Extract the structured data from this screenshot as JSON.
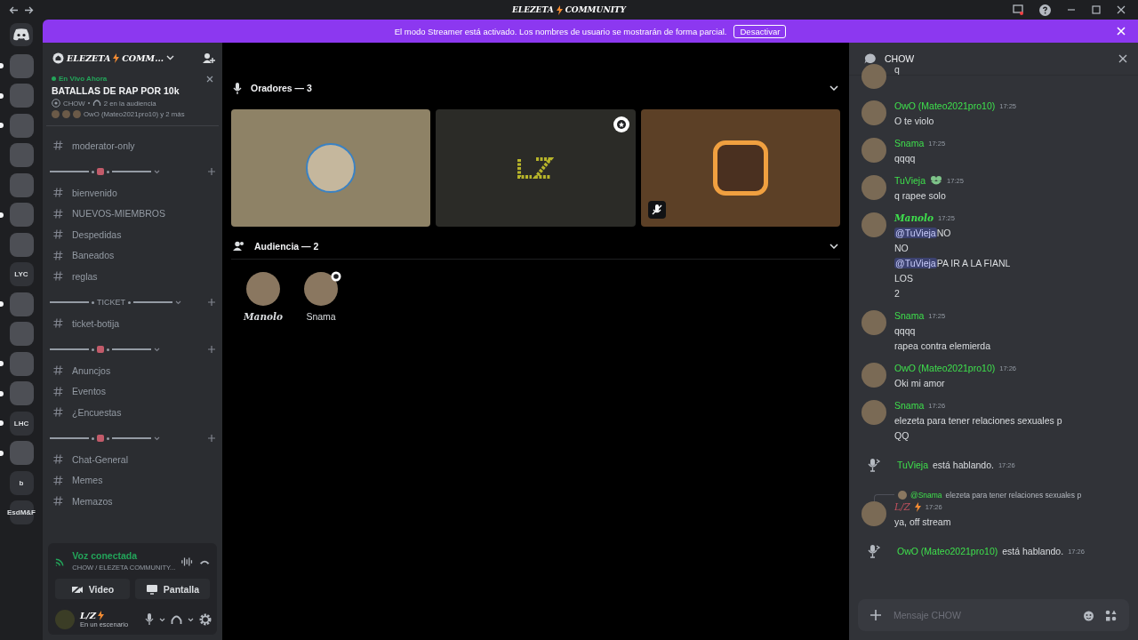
{
  "titlebar": {
    "title": "ELEZETA",
    "title_suffix": "COMMUNITY"
  },
  "banner": {
    "text": "El modo Streamer está activado. Los nombres de usuario se mostrarán de forma parcial.",
    "button": "Desactivar"
  },
  "servers": [
    {
      "unread": true
    },
    {
      "unread": true
    },
    {
      "unread": true
    },
    {
      "unread": false
    },
    {
      "unread": false
    },
    {
      "unread": true
    },
    {
      "unread": false
    },
    {
      "label": "LYC",
      "unread": false
    },
    {
      "unread": true
    },
    {
      "unread": false
    },
    {
      "unread": true
    },
    {
      "unread": true
    },
    {
      "label": "LHC",
      "unread": true
    },
    {
      "unread": true
    },
    {
      "label": "b",
      "unread": false
    },
    {
      "label": "EsdM&F",
      "unread": false
    }
  ],
  "server_header": {
    "name": "ELEZETA",
    "name_suffix": "COMM..."
  },
  "live_card": {
    "status": "En Vivo Ahora",
    "title": "BATALLAS DE RAP POR 10k",
    "channel": "CHOW",
    "audience": "2 en la audiencia",
    "speakers": "OwO (Mateo2021pro10) y 2 más"
  },
  "channels": [
    {
      "kind": "channel",
      "name": "moderator-only"
    },
    {
      "kind": "category"
    },
    {
      "kind": "channel",
      "name": "bienvenido"
    },
    {
      "kind": "channel",
      "name": "NUEVOS-MIEMBROS"
    },
    {
      "kind": "channel",
      "name": "Despedidas"
    },
    {
      "kind": "channel",
      "name": "Baneados"
    },
    {
      "kind": "channel",
      "name": "reglas"
    },
    {
      "kind": "category",
      "label": "TICKET"
    },
    {
      "kind": "channel",
      "name": "ticket-botija"
    },
    {
      "kind": "category"
    },
    {
      "kind": "channel",
      "name": "Anuncjos"
    },
    {
      "kind": "channel",
      "name": "Eventos"
    },
    {
      "kind": "channel",
      "name": "¿Encuestas"
    },
    {
      "kind": "category"
    },
    {
      "kind": "channel",
      "name": "Chat-General"
    },
    {
      "kind": "channel",
      "name": "Memes"
    },
    {
      "kind": "channel",
      "name": "Memazos"
    }
  ],
  "voice_panel": {
    "status": "Voz conectada",
    "location": "CHOW / ELEZETA COMMUNITY...",
    "buttons": [
      "Video",
      "Pantalla"
    ]
  },
  "user": {
    "name": "L/Z",
    "status": "En un escenario"
  },
  "stage": {
    "speakers_header": "Oradores — 3",
    "speakers": [
      {
        "kind": "round",
        "color": "#8e8266",
        "moderator": false,
        "muted": false
      },
      {
        "kind": "logo",
        "color": "#2b2b27",
        "moderator": true,
        "muted": false
      },
      {
        "kind": "framed",
        "color": "#5c4026",
        "moderator": false,
        "muted": true
      }
    ],
    "audience_header": "Audiencia — 2",
    "audience": [
      {
        "kind": "script",
        "name": "Manolo",
        "badge": false
      },
      {
        "kind": "plain",
        "name": "Snama",
        "badge": true
      }
    ]
  },
  "chat": {
    "title": "CHOW",
    "placeholder": "Mensaje CHOW",
    "items": [
      {
        "kind": "continued",
        "lines": [
          {
            "text": "q"
          }
        ]
      },
      {
        "kind": "message",
        "author": "OwO (Mateo2021pro10)",
        "badge": false,
        "time": "17:25",
        "lines": [
          {
            "text": "O te violo"
          }
        ]
      },
      {
        "kind": "message",
        "author": "Snama",
        "badge": false,
        "time": "17:25",
        "lines": [
          {
            "text": "qqqq"
          }
        ]
      },
      {
        "kind": "message",
        "author": "TuVieja",
        "badge": true,
        "time": "17:25",
        "lines": [
          {
            "text": "q rapee solo"
          }
        ]
      },
      {
        "kind": "script",
        "author": "Manolo",
        "badge": false,
        "time": "17:25",
        "lines": [
          {
            "mention": "@TuVieja",
            "text": "NO"
          },
          {
            "text": "NO"
          },
          {
            "mention": "@TuVieja",
            "text": "PA IR A LA FIANL"
          },
          {
            "text": "LOS"
          },
          {
            "text": "2"
          }
        ]
      },
      {
        "kind": "message",
        "author": "Snama",
        "badge": false,
        "time": "17:25",
        "lines": [
          {
            "text": "qqqq"
          },
          {
            "text": "rapea contra elemierda"
          }
        ]
      },
      {
        "kind": "message",
        "author": "OwO (Mateo2021pro10)",
        "badge": false,
        "time": "17:26",
        "lines": [
          {
            "text": "Oki mi amor"
          }
        ]
      },
      {
        "kind": "message",
        "author": "Snama",
        "badge": false,
        "time": "17:26",
        "lines": [
          {
            "text": "elezeta para tener relaciones sexuales p"
          },
          {
            "text": "QQ"
          }
        ]
      },
      {
        "kind": "system",
        "author": "TuVieja",
        "text": "está hablando.",
        "time": "17:26"
      },
      {
        "kind": "dark",
        "author": "L/Z",
        "badge": false,
        "time": "17:26",
        "reply": {
          "author": "@Snama",
          "text": "elezeta para tener relaciones sexuales p"
        },
        "lines": [
          {
            "text": "ya, off stream"
          }
        ]
      },
      {
        "kind": "system",
        "author": "OwO (Mateo2021pro10)",
        "text": "está hablando.",
        "time": "17:26"
      }
    ]
  }
}
